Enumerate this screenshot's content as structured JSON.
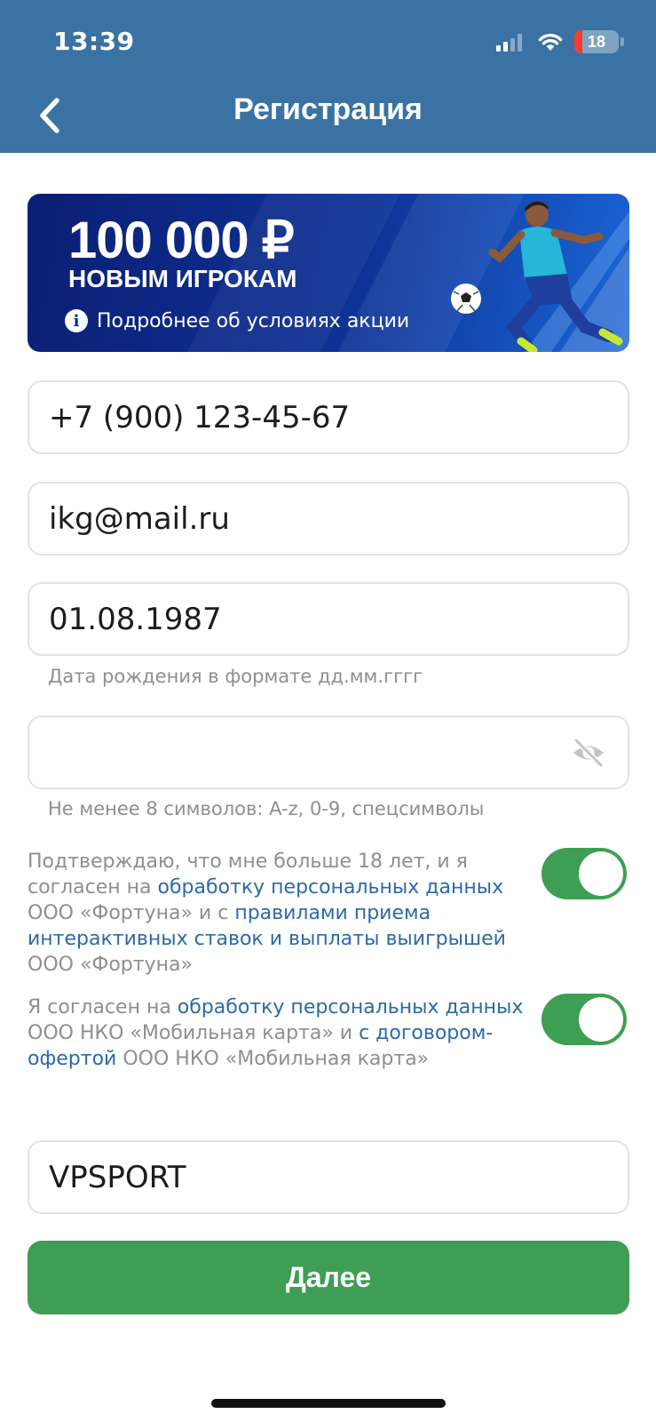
{
  "status_bar": {
    "time": "13:39",
    "battery_level": "18",
    "battery_fraction": 0.18,
    "battery_color": "#ff3b30",
    "signal_bars_active": 2,
    "icons": [
      "signal-icon",
      "wifi-icon",
      "battery-icon"
    ]
  },
  "nav": {
    "title": "Регистрация",
    "back_icon": "chevron-left-icon"
  },
  "banner": {
    "amount": "100 000 ₽",
    "subtitle": "НОВЫМ ИГРОКАМ",
    "info_icon": "i",
    "info_text": "Подробнее об условиях акции"
  },
  "form": {
    "phone": {
      "value": "+7 (900) 123-45-67"
    },
    "email": {
      "value": "ikg@mail.ru"
    },
    "birthdate": {
      "value": "01.08.1987",
      "hint": "Дата рождения в формате дд.мм.гггг"
    },
    "password": {
      "value": "",
      "hint": "Не менее 8 символов: A-z, 0-9, спецсимволы",
      "icon": "eye-off-icon"
    },
    "promo": {
      "value": "VPSPORT"
    }
  },
  "consents": [
    {
      "text_1": "Подтверждаю, что мне больше 18 лет, и я согласен на ",
      "link_1": "обработку персональных данных",
      "text_2": " ООО «Фортуна» и с ",
      "link_2": "правилами приема интерактивных ставок и выплаты выигрышей",
      "text_3": " ООО «Фортуна»",
      "checked": true
    },
    {
      "text_1": "Я согласен на ",
      "link_1": "обработку персональных данных",
      "text_2": " ООО НКО «Мобильная карта» и ",
      "link_2": "с договором-офертой",
      "text_3": " ООО НКО «Мобильная карта»",
      "checked": true
    }
  ],
  "submit_label": "Далее",
  "colors": {
    "header": "#3a72a4",
    "accent_green": "#3e9e53",
    "link": "#2c6aa8",
    "hint": "#8e8e93",
    "border": "#e3e3e6"
  }
}
